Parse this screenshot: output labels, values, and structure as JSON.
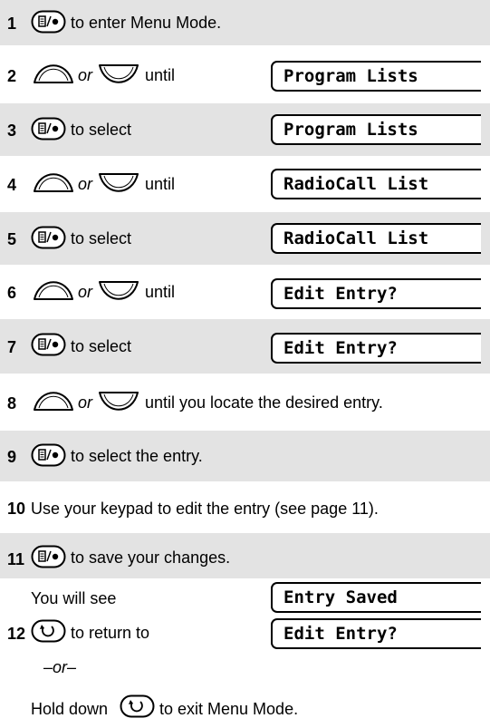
{
  "steps": [
    {
      "num": "1",
      "a": "to enter Menu Mode."
    },
    {
      "num": "2",
      "or": "or",
      "a": "until",
      "display": "Program Lists"
    },
    {
      "num": "3",
      "a": "to select",
      "display": "Program Lists"
    },
    {
      "num": "4",
      "or": "or",
      "a": "until",
      "display": "RadioCall List"
    },
    {
      "num": "5",
      "a": "to select",
      "display": "RadioCall List"
    },
    {
      "num": "6",
      "or": "or",
      "a": "until",
      "display": "Edit Entry?"
    },
    {
      "num": "7",
      "a": "to select",
      "display": "Edit Entry?"
    },
    {
      "num": "8",
      "or": "or",
      "a": "until you locate the desired entry."
    },
    {
      "num": "9",
      "a": "to select the entry."
    },
    {
      "num": "10",
      "a": "Use your keypad to edit the entry (see page 11)."
    },
    {
      "num": "11",
      "a": "to save your changes.",
      "sub": "You will see",
      "display": "Entry Saved"
    },
    {
      "num": "12",
      "a": "to return to",
      "display": "Edit Entry?",
      "or_line": "–or–",
      "hold_a": "Hold down",
      "hold_b": "to exit Menu Mode."
    }
  ]
}
